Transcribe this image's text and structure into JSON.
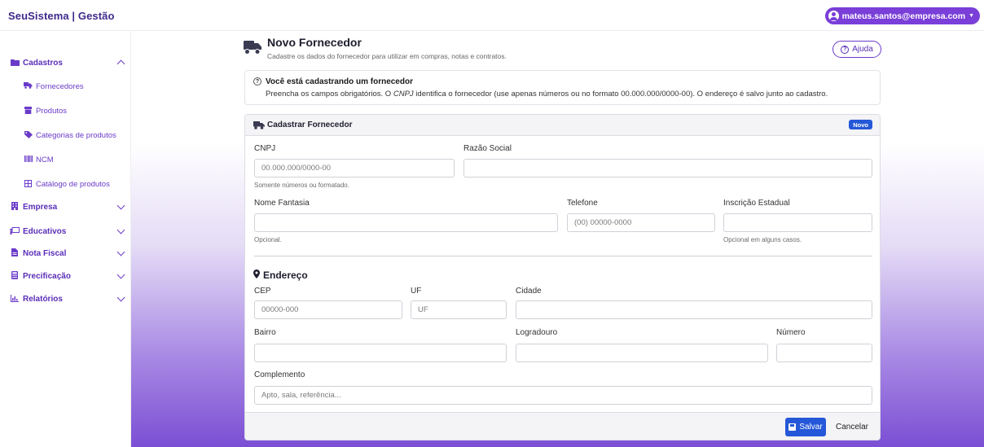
{
  "header": {
    "brand": "SeuSistema | Gestão",
    "user_email": "mateus.santos@empresa.com"
  },
  "sidebar": {
    "groups": [
      {
        "label": "Cadastros",
        "icon": "folder-icon",
        "expanded": true
      },
      {
        "label": "Empresa",
        "icon": "building-icon",
        "expanded": false
      },
      {
        "label": "Educativos",
        "icon": "chalkboard-icon",
        "expanded": false
      },
      {
        "label": "Nota Fiscal",
        "icon": "file-icon",
        "expanded": false
      },
      {
        "label": "Precificação",
        "icon": "calculator-icon",
        "expanded": false
      },
      {
        "label": "Relatórios",
        "icon": "chart-icon",
        "expanded": false
      }
    ],
    "cadastros_items": [
      {
        "label": "Fornecedores",
        "icon": "truck-icon"
      },
      {
        "label": "Produtos",
        "icon": "box-icon"
      },
      {
        "label": "Categorias de produtos",
        "icon": "tag-icon"
      },
      {
        "label": "NCM",
        "icon": "barcode-icon"
      },
      {
        "label": "Catálogo de produtos",
        "icon": "grid-icon"
      }
    ]
  },
  "page": {
    "title": "Novo Fornecedor",
    "subtitle": "Cadastre os dados do fornecedor para utilizar em compras, notas e contratos.",
    "help_label": "Ajuda"
  },
  "info": {
    "title": "Você está cadastrando um fornecedor",
    "text_before": "Preencha os campos obrigatórios. O ",
    "text_em": "CNPJ",
    "text_after": " identifica o fornecedor (use apenas números ou no formato 00.000.000/0000-00). O endereço é salvo junto ao cadastro."
  },
  "form": {
    "card_title": "Cadastrar Fornecedor",
    "badge": "Novo",
    "cnpj": {
      "label": "CNPJ",
      "placeholder": "00.000.000/0000-00",
      "hint": "Somente números ou formatado.",
      "value": ""
    },
    "razao_social": {
      "label": "Razão Social",
      "placeholder": "",
      "value": ""
    },
    "nome_fantasia": {
      "label": "Nome Fantasia",
      "placeholder": "",
      "hint": "Opcional.",
      "value": ""
    },
    "telefone": {
      "label": "Telefone",
      "placeholder": "(00) 00000-0000",
      "value": ""
    },
    "inscricao_estadual": {
      "label": "Inscrição Estadual",
      "placeholder": "",
      "hint": "Opcional em alguns casos.",
      "value": ""
    },
    "endereco_title": "Endereço",
    "cep": {
      "label": "CEP",
      "placeholder": "00000-000",
      "value": ""
    },
    "uf": {
      "label": "UF",
      "placeholder": "UF",
      "value": ""
    },
    "cidade": {
      "label": "Cidade",
      "placeholder": "",
      "value": ""
    },
    "bairro": {
      "label": "Bairro",
      "placeholder": "",
      "value": ""
    },
    "logradouro": {
      "label": "Logradouro",
      "placeholder": "",
      "value": ""
    },
    "numero": {
      "label": "Número",
      "placeholder": "",
      "value": ""
    },
    "complemento": {
      "label": "Complemento",
      "placeholder": "Apto, sala, referência...",
      "value": ""
    },
    "save_label": "Salvar",
    "cancel_label": "Cancelar"
  },
  "colors": {
    "accent": "#7a3fd8",
    "primary_button": "#2558d8",
    "brand_text": "#3f2a8c"
  }
}
